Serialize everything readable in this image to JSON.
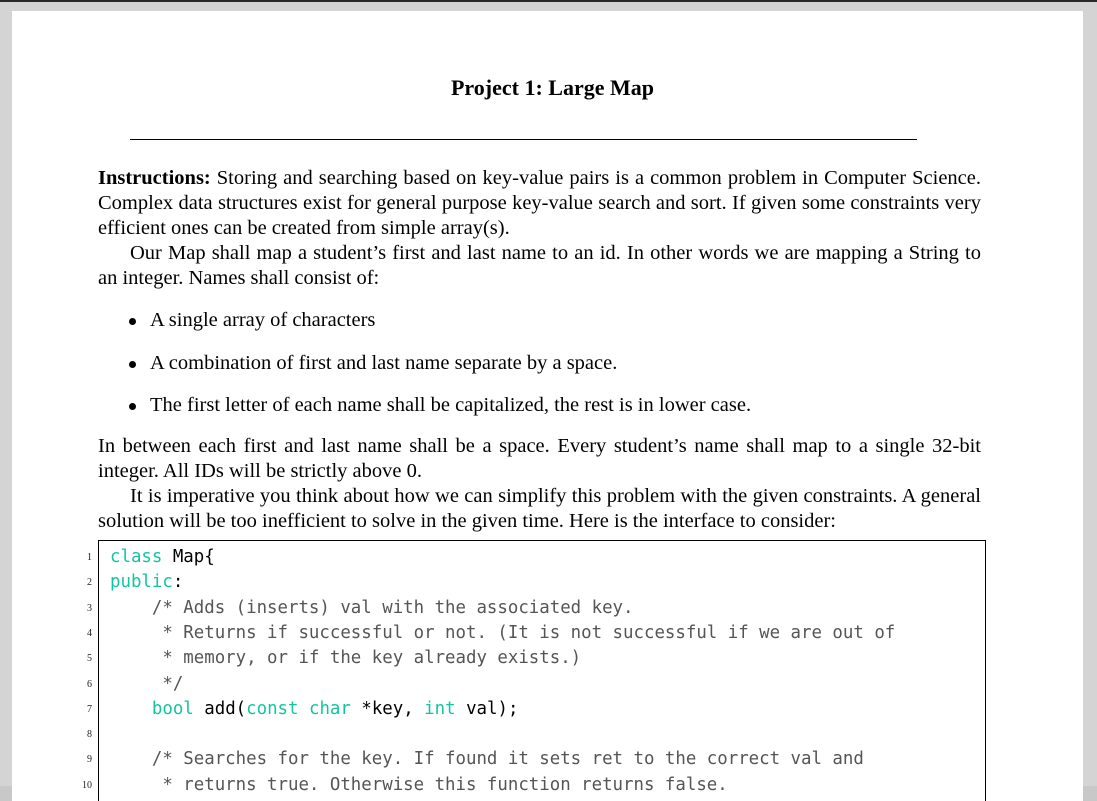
{
  "document": {
    "title": "Project 1: Large Map",
    "intro": {
      "label": "Instructions:",
      "text": " Storing and searching based on key-value pairs is a common problem in Computer Science. Complex data structures exist for general purpose key-value search and sort. If given some constraints very efficient ones can be created from simple array(s)."
    },
    "para2": "Our Map shall map a student’s first and last name to an id. In other words we are mapping a String to an integer. Names shall consist of:",
    "bullets": [
      "A single array of characters",
      "A combination of first and last name separate by a space.",
      "The first letter of each name shall be capitalized, the rest is in lower case."
    ],
    "para3": "In between each first and last name shall be a space. Every student’s name shall map to a single 32-bit integer. All IDs will be strictly above 0.",
    "para4": "It is imperative you think about how we can simplify this problem with the given constraints. A general solution will be too inefficient to solve in the given time. Here is the interface to consider:"
  },
  "code": {
    "line_numbers": [
      "1",
      "2",
      "3",
      "4",
      "5",
      "6",
      "7",
      "8",
      "9",
      "10"
    ],
    "lines": [
      [
        {
          "t": "class",
          "k": "kw"
        },
        {
          "t": " Map{",
          "k": ""
        }
      ],
      [
        {
          "t": "public",
          "k": "kw"
        },
        {
          "t": ":",
          "k": ""
        }
      ],
      [
        {
          "t": "    /* Adds (inserts) val with the associated key.",
          "k": "cm"
        }
      ],
      [
        {
          "t": "     * Returns if successful or not. (It is not successful if we are out of",
          "k": "cm"
        }
      ],
      [
        {
          "t": "     * memory, or if the key already exists.)",
          "k": "cm"
        }
      ],
      [
        {
          "t": "     */",
          "k": "cm"
        }
      ],
      [
        {
          "t": "    ",
          "k": ""
        },
        {
          "t": "bool",
          "k": "kw"
        },
        {
          "t": " add(",
          "k": ""
        },
        {
          "t": "const",
          "k": "kw"
        },
        {
          "t": " ",
          "k": ""
        },
        {
          "t": "char",
          "k": "kw"
        },
        {
          "t": " *key, ",
          "k": ""
        },
        {
          "t": "int",
          "k": "kw"
        },
        {
          "t": " val);",
          "k": ""
        }
      ],
      [
        {
          "t": "",
          "k": ""
        }
      ],
      [
        {
          "t": "    /* Searches for the key. If found it sets ret to the correct val and",
          "k": "cm"
        }
      ],
      [
        {
          "t": "     * returns true. Otherwise this function returns false.",
          "k": "cm"
        }
      ]
    ]
  },
  "colors": {
    "keyword": "#13c4a3",
    "comment": "#555555"
  }
}
